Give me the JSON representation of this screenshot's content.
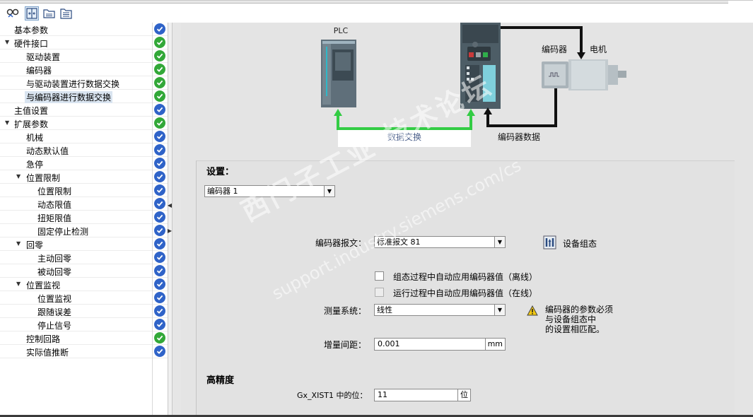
{
  "tree": {
    "items": [
      {
        "label": "基本参数",
        "level": 0,
        "expand": "",
        "status": "blue"
      },
      {
        "label": "硬件接口",
        "level": 0,
        "expand": "▼",
        "status": "green"
      },
      {
        "label": "驱动装置",
        "level": 1,
        "expand": "",
        "status": "green"
      },
      {
        "label": "编码器",
        "level": 1,
        "expand": "",
        "status": "green"
      },
      {
        "label": "与驱动装置进行数据交换",
        "level": 1,
        "expand": "",
        "status": "green"
      },
      {
        "label": "与编码器进行数据交换",
        "level": 1,
        "expand": "",
        "status": "green",
        "selected": true
      },
      {
        "label": "主值设置",
        "level": 0,
        "expand": "",
        "status": "blue"
      },
      {
        "label": "扩展参数",
        "level": 0,
        "expand": "▼",
        "status": "green"
      },
      {
        "label": "机械",
        "level": 1,
        "expand": "",
        "status": "blue"
      },
      {
        "label": "动态默认值",
        "level": 1,
        "expand": "",
        "status": "blue"
      },
      {
        "label": "急停",
        "level": 1,
        "expand": "",
        "status": "blue"
      },
      {
        "label": "位置限制",
        "level": 1,
        "expand": "▼",
        "status": "blue"
      },
      {
        "label": "位置限制",
        "level": 2,
        "expand": "",
        "status": "blue"
      },
      {
        "label": "动态限值",
        "level": 2,
        "expand": "",
        "status": "blue"
      },
      {
        "label": "扭矩限值",
        "level": 2,
        "expand": "",
        "status": "blue"
      },
      {
        "label": "固定停止检测",
        "level": 2,
        "expand": "",
        "status": "blue"
      },
      {
        "label": "回零",
        "level": 1,
        "expand": "▼",
        "status": "blue"
      },
      {
        "label": "主动回零",
        "level": 2,
        "expand": "",
        "status": "blue"
      },
      {
        "label": "被动回零",
        "level": 2,
        "expand": "",
        "status": "blue"
      },
      {
        "label": "位置监视",
        "level": 1,
        "expand": "▼",
        "status": "blue"
      },
      {
        "label": "位置监视",
        "level": 2,
        "expand": "",
        "status": "blue"
      },
      {
        "label": "跟随误差",
        "level": 2,
        "expand": "",
        "status": "blue"
      },
      {
        "label": "停止信号",
        "level": 2,
        "expand": "",
        "status": "blue"
      },
      {
        "label": "控制回路",
        "level": 1,
        "expand": "",
        "status": "green"
      },
      {
        "label": "实际值推断",
        "level": 1,
        "expand": "",
        "status": "blue"
      }
    ]
  },
  "diagram": {
    "plc_label": "PLC",
    "encoder_label": "编码器",
    "motor_label": "电机",
    "data_exchange_label": "数据交换",
    "encoder_data_label": "编码器数据"
  },
  "settings": {
    "title": "设置：",
    "encoder_select": "编码器 1",
    "telegram_label": "编码器报文：",
    "telegram_value": "标准报文 81",
    "device_config_label": "设备组态",
    "chk_offline_label": "组态过程中自动应用编码器值（离线）",
    "chk_online_label": "运行过程中自动应用编码器值（在线）",
    "measure_label": "测量系统：",
    "measure_value": "线性",
    "warning_line1": "编码器的参数必须",
    "warning_line2": "与设备组态中",
    "warning_line3": "的设置相匹配。",
    "increment_label": "增量间距：",
    "increment_value": "0.001",
    "increment_unit": "mm",
    "precision_title": "高精度",
    "bits_label": "Gx_XIST1 中的位：",
    "bits_value": "11",
    "bits_unit": "位"
  },
  "watermark": {
    "line1": "西门子工业 技术论坛",
    "line2": "support.industry.siemens.com/cs"
  },
  "colors": {
    "status_blue": "#2f63c8",
    "status_green": "#32a838",
    "link_green": "#33cc44",
    "link_black": "#111111"
  }
}
